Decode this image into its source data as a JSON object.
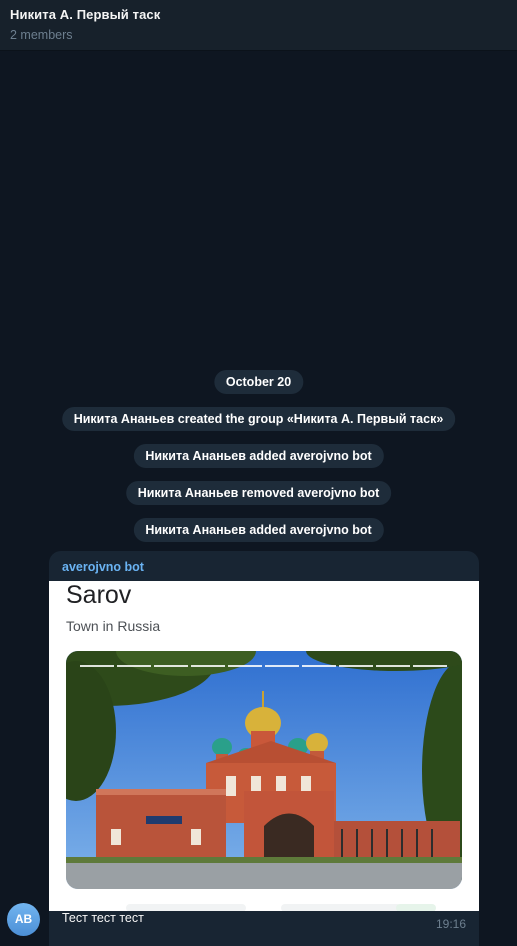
{
  "header": {
    "title": "Никита А. Первый таск",
    "subtitle": "2 members"
  },
  "service_messages": [
    "October 20",
    "Никита Ананьев created the group «Никита А. Первый таск»",
    "Никита Ананьев added averojvno bot",
    "Никита Ананьев removed averojvno bot",
    "Никита Ананьев added averojvno bot"
  ],
  "message": {
    "sender": "averojvno bot",
    "card_title": "Sarov",
    "card_subtitle": "Town in Russia",
    "avatar_initials": "AB",
    "text": "Тест тест тест",
    "time": "19:16"
  },
  "colors": {
    "background": "#0e1621",
    "header": "#17212b",
    "bubble": "#182533",
    "service_pill": "#1e2c3a",
    "sender_name": "#6ab3f3",
    "secondary_text": "#6d7f8f"
  },
  "icons": {
    "avatar": "user-avatar-icon"
  }
}
